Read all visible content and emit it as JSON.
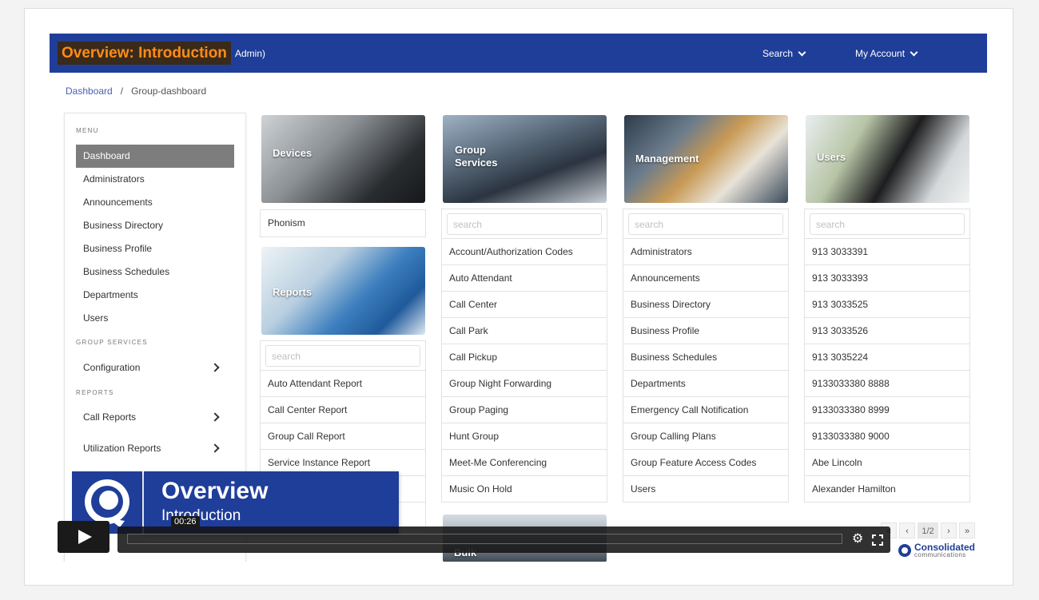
{
  "header": {
    "overlay_title": "Overview: Introduction",
    "peek_text": "Admin)",
    "search_label": "Search",
    "account_label": "My Account",
    "bar_color": "#1f3e99"
  },
  "breadcrumb": [
    "Dashboard",
    "Group-dashboard"
  ],
  "sidebar": {
    "menu_heading": "MENU",
    "menu_items": [
      "Dashboard",
      "Administrators",
      "Announcements",
      "Business Directory",
      "Business Profile",
      "Business Schedules",
      "Departments",
      "Users"
    ],
    "active_item": "Dashboard",
    "group_services_heading": "GROUP SERVICES",
    "configuration": "Configuration",
    "reports_heading": "REPORTS",
    "call_reports": "Call Reports",
    "utilization_reports": "Utilization Reports"
  },
  "cards": {
    "devices": {
      "title": "Devices",
      "items": [
        "Phonism"
      ]
    },
    "reports": {
      "title": "Reports",
      "search_placeholder": "search",
      "items": [
        "Auto Attendant Report",
        "Call Center Report",
        "Group Call Report",
        "Service Instance Report"
      ]
    },
    "group_services": {
      "title_line1": "Group",
      "title_line2": "Services",
      "search_placeholder": "search",
      "items": [
        "Account/Authorization Codes",
        "Auto Attendant",
        "Call Center",
        "Call Park",
        "Call Pickup",
        "Group Night Forwarding",
        "Group Paging",
        "Hunt Group",
        "Meet-Me Conferencing",
        "Music On Hold"
      ]
    },
    "management": {
      "title": "Management",
      "search_placeholder": "search",
      "items": [
        "Administrators",
        "Announcements",
        "Business Directory",
        "Business Profile",
        "Business Schedules",
        "Departments",
        "Emergency Call Notification",
        "Group Calling Plans",
        "Group Feature Access Codes",
        "Users"
      ]
    },
    "users": {
      "title": "Users",
      "search_placeholder": "search",
      "items": [
        "913 3033391",
        "913 3033393",
        "913 3033525",
        "913 3033526",
        "913 3035224",
        "9133033380 8888",
        "9133033380 8999",
        "9133033380 9000",
        "Abe Lincoln",
        "Alexander Hamilton"
      ]
    },
    "bulk": {
      "title": "Bulk"
    }
  },
  "pager": {
    "first": "«",
    "prev": "‹",
    "current": "1/2",
    "next": "›",
    "last": "»"
  },
  "logo": {
    "name": "Consolidated",
    "sub": "communications"
  },
  "video": {
    "lower_third_title": "Overview",
    "lower_third_subtitle": "Introduction",
    "time": "00:26",
    "icons": [
      "play-icon",
      "gear-icon",
      "fullscreen-icon"
    ]
  }
}
